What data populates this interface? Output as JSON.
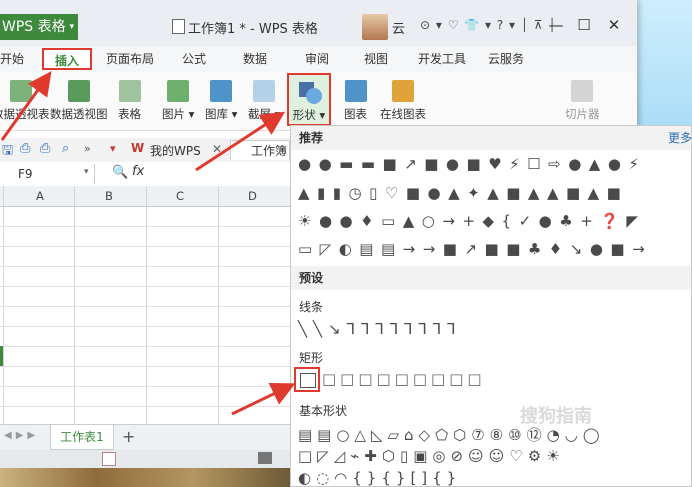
{
  "app": {
    "name": "WPS 表格",
    "doc_title": "工作簿1 * - WPS 表格",
    "user": "云"
  },
  "titlebar": {
    "icons_text": "⊙ ▾ ♡ 👕 ▾ ? ▾ │ ⊼ │"
  },
  "menu_tabs": [
    "开始",
    "插入",
    "页面布局",
    "公式",
    "数据",
    "审阅",
    "视图",
    "开发工具",
    "云服务"
  ],
  "ribbon": {
    "items": [
      "数据透视表",
      "数据透视图",
      "表格",
      "图片 ▾",
      "图库 ▾",
      "截屏 ▾",
      "形状 ▾",
      "图表",
      "在线图表",
      "切片器"
    ]
  },
  "quickbar": {
    "mywps": "我的WPS",
    "doc_tab": "工作簿"
  },
  "formula_bar": {
    "cell_ref": "F9",
    "fx_label": "fx"
  },
  "grid": {
    "columns": [
      "A",
      "B",
      "C",
      "D"
    ]
  },
  "sheet": {
    "tab_label": "工作表1",
    "add_label": "+"
  },
  "shapes_panel": {
    "recommended_title": "推荐",
    "more_label": "更多",
    "preset_title": "预设",
    "lines_title": "线条",
    "rect_title": "矩形",
    "basic_title": "基本形状",
    "recommended_rows": [
      "●●▬▬■↗■●■♥⚡☐⇨●▲●⚡",
      "▲▮▮◷▯♡■●▲✦▲■▲▲■▲■",
      "☀●●♦▭▲○→+◆{✓●♣+❓◤",
      "▭◸◐▤▤→→■↗■■♣♦↘●■→"
    ],
    "lines_row": "╲╲↘⅂⅂⅂⅂⅂⅂⅂⅂",
    "rect_row": "□□□□□□□□□",
    "basic_rows": [
      "▤▤○△◺▱⌂◇⬠⬡⑦⑧⑩⑫◔◡◯",
      "□◸◿⌁✚⬡▯▣◎⊘☺☺♡⚙☀",
      "◐◌◠{}{}[]{}"
    ]
  },
  "watermark": "搜狗指南",
  "colors": {
    "accent_green": "#3d8a3d",
    "highlight_red": "#e03a2f"
  }
}
